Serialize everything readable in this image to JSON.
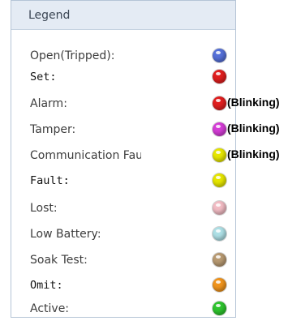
{
  "legend": {
    "title": "Legend",
    "blinking_label": "(Blinking)",
    "items": [
      {
        "label": "Open(Tripped):",
        "color": "#5570d8",
        "blinking": false,
        "mono": false
      },
      {
        "label": "Set:",
        "color": "#e01e1e",
        "blinking": false,
        "mono": true
      },
      {
        "label": "Alarm:",
        "color": "#e01e1e",
        "blinking": true,
        "mono": false
      },
      {
        "label": "Tamper:",
        "color": "#d43ed6",
        "blinking": true,
        "mono": false
      },
      {
        "label": "Communication Fault:",
        "color": "#e6e600",
        "blinking": true,
        "mono": false
      },
      {
        "label": "Fault:",
        "color": "#e6e600",
        "blinking": false,
        "mono": true
      },
      {
        "label": "Lost:",
        "color": "#f2bcc4",
        "blinking": false,
        "mono": false
      },
      {
        "label": "Low Battery:",
        "color": "#aee0e6",
        "blinking": false,
        "mono": false
      },
      {
        "label": "Soak Test:",
        "color": "#b89a72",
        "blinking": false,
        "mono": false
      },
      {
        "label": "Omit:",
        "color": "#f0941c",
        "blinking": false,
        "mono": true
      },
      {
        "label": "Active:",
        "color": "#2ec42e",
        "blinking": false,
        "mono": false
      }
    ]
  }
}
